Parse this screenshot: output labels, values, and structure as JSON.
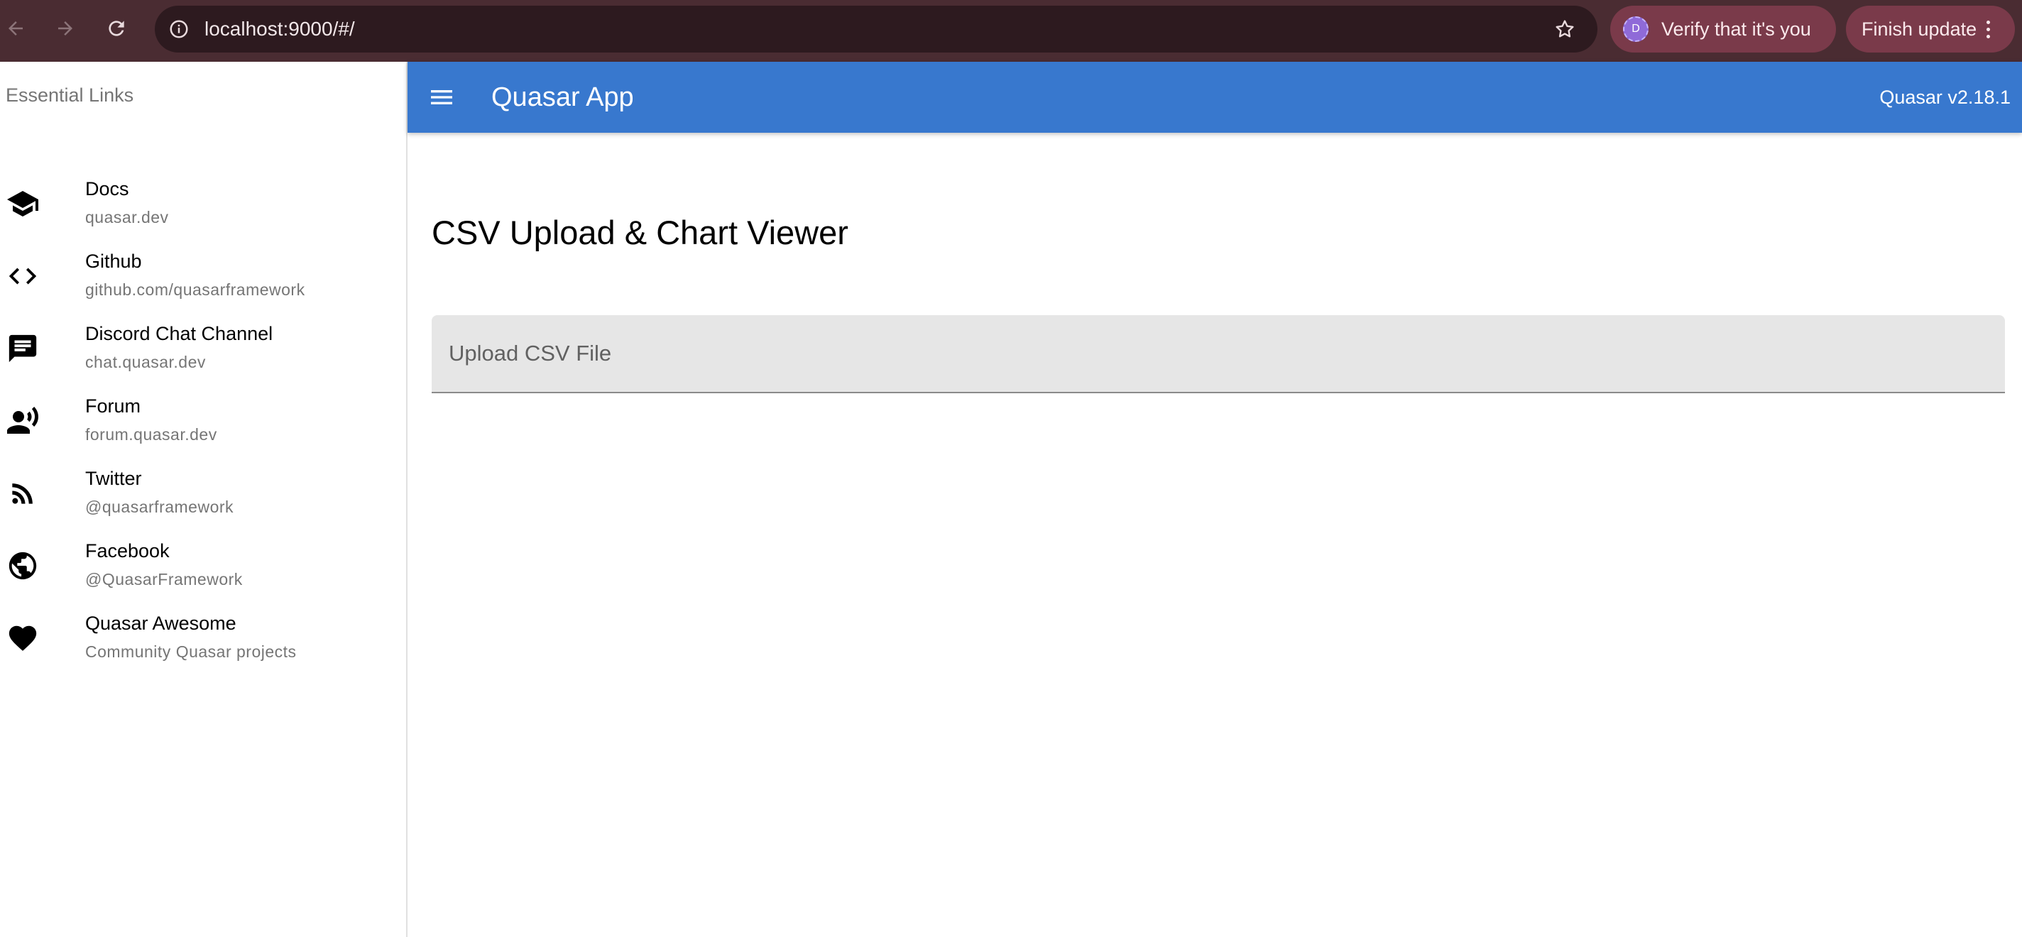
{
  "browser": {
    "url": "localhost:9000/#/",
    "profile_initial": "D",
    "verify_label": "Verify that it's you",
    "finish_label": "Finish update"
  },
  "header": {
    "title": "Quasar App",
    "version": "Quasar v2.18.1",
    "color": "#3878ce"
  },
  "drawer": {
    "header": "Essential Links",
    "links": [
      {
        "title": "Docs",
        "caption": "quasar.dev",
        "icon": "school-icon"
      },
      {
        "title": "Github",
        "caption": "github.com/quasarframework",
        "icon": "code-icon"
      },
      {
        "title": "Discord Chat Channel",
        "caption": "chat.quasar.dev",
        "icon": "chat-icon"
      },
      {
        "title": "Forum",
        "caption": "forum.quasar.dev",
        "icon": "record-voice-icon"
      },
      {
        "title": "Twitter",
        "caption": "@quasarframework",
        "icon": "rss-feed-icon"
      },
      {
        "title": "Facebook",
        "caption": "@QuasarFramework",
        "icon": "public-icon"
      },
      {
        "title": "Quasar Awesome",
        "caption": "Community Quasar projects",
        "icon": "favorite-icon"
      }
    ]
  },
  "main": {
    "title": "CSV Upload & Chart Viewer",
    "file_input_label": "Upload CSV File"
  }
}
